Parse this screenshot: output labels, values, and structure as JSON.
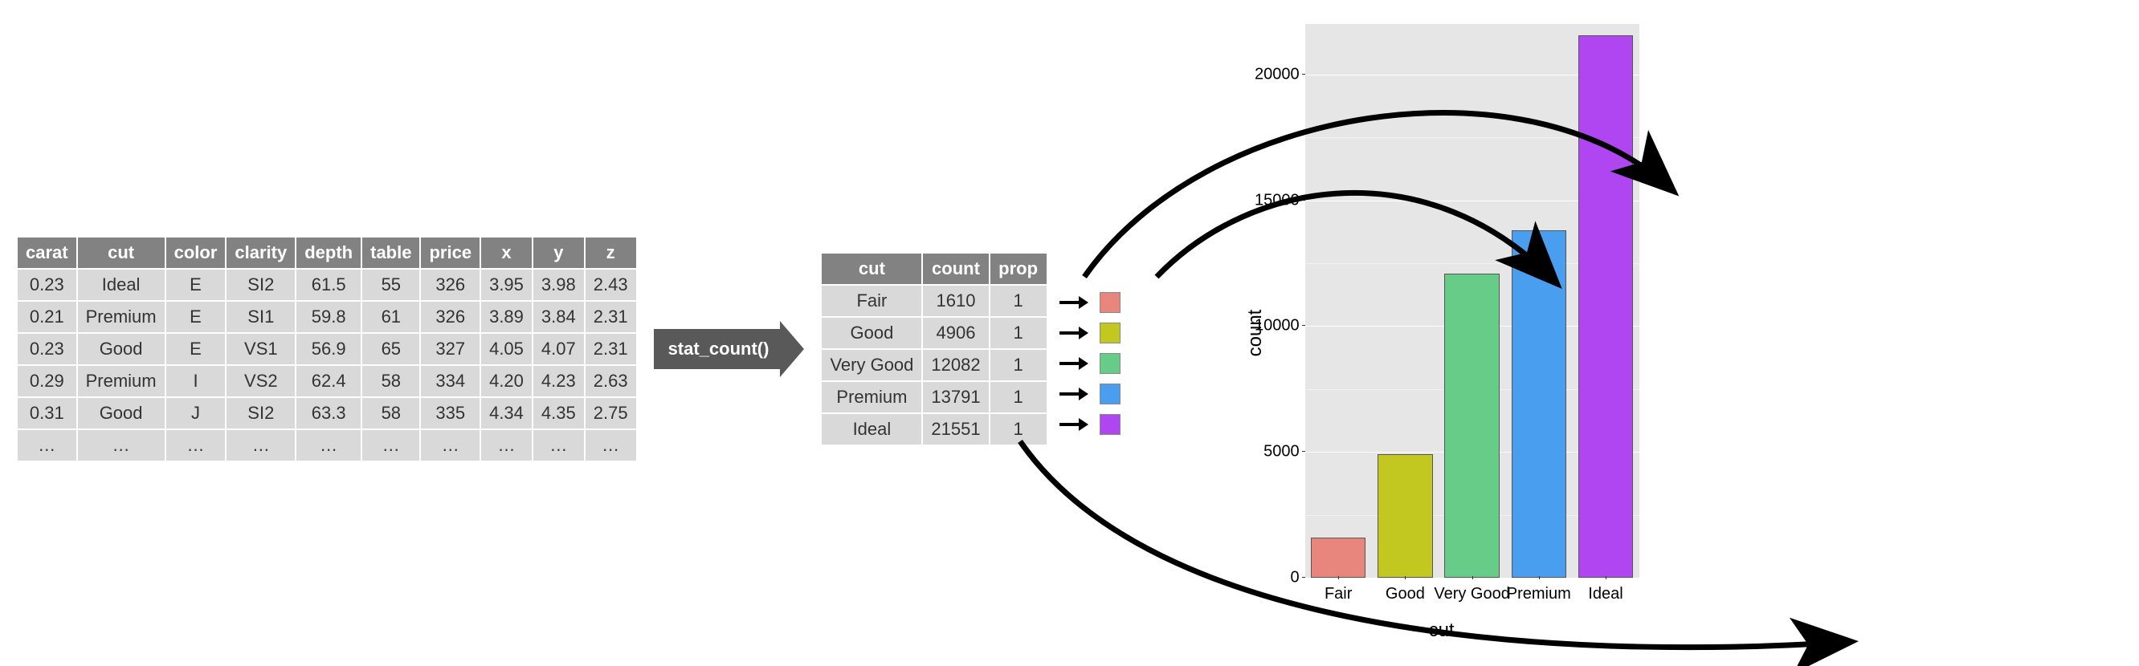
{
  "raw_table": {
    "headers": [
      "carat",
      "cut",
      "color",
      "clarity",
      "depth",
      "table",
      "price",
      "x",
      "y",
      "z"
    ],
    "rows": [
      [
        "0.23",
        "Ideal",
        "E",
        "SI2",
        "61.5",
        "55",
        "326",
        "3.95",
        "3.98",
        "2.43"
      ],
      [
        "0.21",
        "Premium",
        "E",
        "SI1",
        "59.8",
        "61",
        "326",
        "3.89",
        "3.84",
        "2.31"
      ],
      [
        "0.23",
        "Good",
        "E",
        "VS1",
        "56.9",
        "65",
        "327",
        "4.05",
        "4.07",
        "2.31"
      ],
      [
        "0.29",
        "Premium",
        "I",
        "VS2",
        "62.4",
        "58",
        "334",
        "4.20",
        "4.23",
        "2.63"
      ],
      [
        "0.31",
        "Good",
        "J",
        "SI2",
        "63.3",
        "58",
        "335",
        "4.34",
        "4.35",
        "2.75"
      ],
      [
        "…",
        "…",
        "…",
        "…",
        "…",
        "…",
        "…",
        "…",
        "…",
        "…"
      ]
    ]
  },
  "transform_label": "stat_count()",
  "stat_table": {
    "headers": [
      "cut",
      "count",
      "prop"
    ],
    "rows": [
      {
        "cut": "Fair",
        "count": "1610",
        "prop": "1",
        "swatch": "#e8857d"
      },
      {
        "cut": "Good",
        "count": "4906",
        "prop": "1",
        "swatch": "#c3c821"
      },
      {
        "cut": "Very Good",
        "count": "12082",
        "prop": "1",
        "swatch": "#66cc87"
      },
      {
        "cut": "Premium",
        "count": "13791",
        "prop": "1",
        "swatch": "#4a9ef0"
      },
      {
        "cut": "Ideal",
        "count": "21551",
        "prop": "1",
        "swatch": "#b045f2"
      }
    ]
  },
  "chart_data": {
    "type": "bar",
    "categories": [
      "Fair",
      "Good",
      "Very Good",
      "Premium",
      "Ideal"
    ],
    "values": [
      1610,
      4906,
      12082,
      13791,
      21551
    ],
    "colors": [
      "#e8857d",
      "#c3c821",
      "#66cc87",
      "#4a9ef0",
      "#b045f2"
    ],
    "ylabel": "count",
    "xlabel": "cut",
    "ylim": [
      0,
      22000
    ],
    "yticks": [
      0,
      5000,
      10000,
      15000,
      20000
    ]
  }
}
